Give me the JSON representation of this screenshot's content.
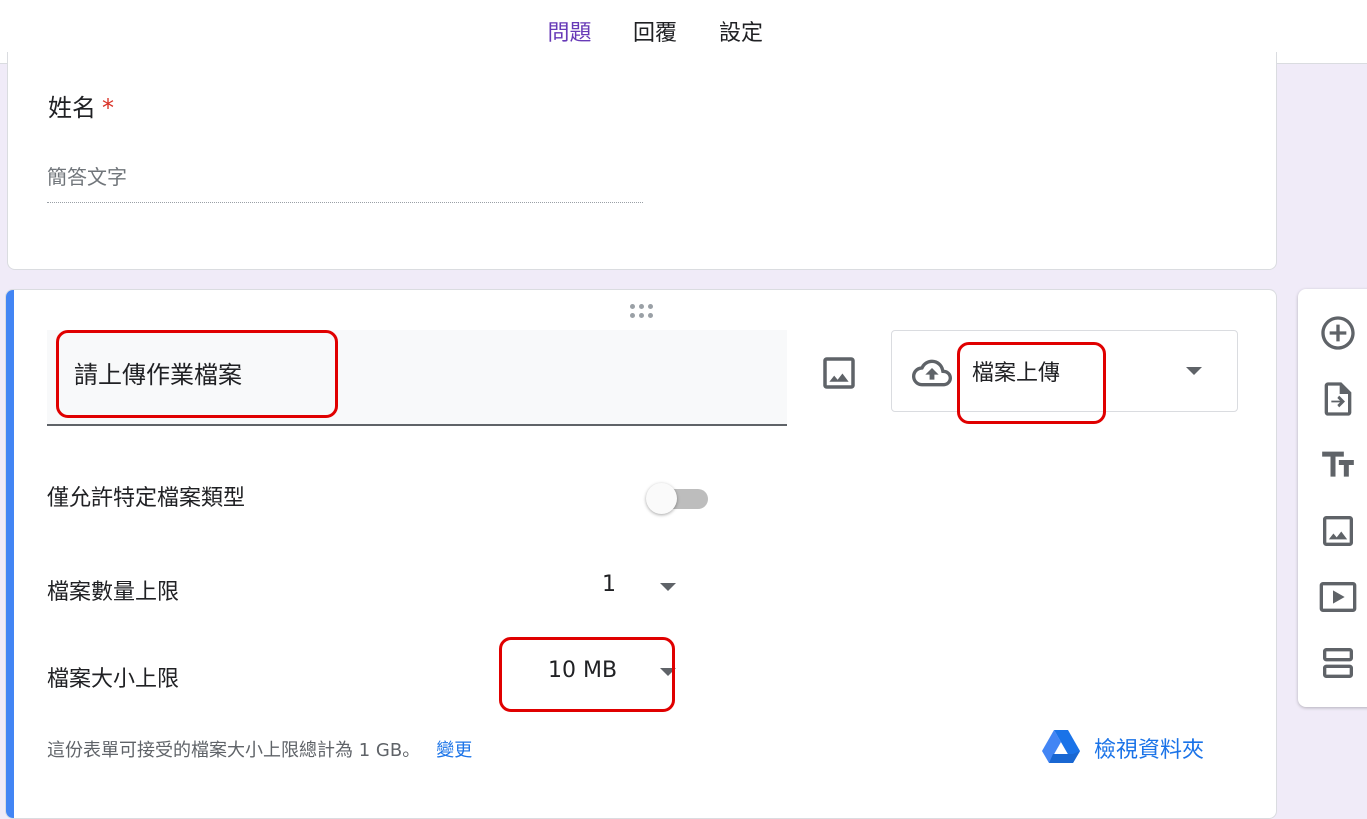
{
  "tabs": [
    {
      "label": "問題",
      "active": true
    },
    {
      "label": "回覆",
      "active": false
    },
    {
      "label": "設定",
      "active": false
    }
  ],
  "name_question": {
    "title": "姓名",
    "required_marker": "*",
    "answer_placeholder": "簡答文字"
  },
  "upload_question": {
    "title": "請上傳作業檔案",
    "type_label": "檔案上傳",
    "type_icon": "cloud-upload-icon",
    "allow_types_label": "僅允許特定檔案類型",
    "allow_types_enabled": false,
    "max_count_label": "檔案數量上限",
    "max_count_value": "1",
    "max_size_label": "檔案大小上限",
    "max_size_value": "10 MB",
    "note_text": "這份表單可接受的檔案大小上限總計為 1 GB。",
    "note_link": "變更",
    "drive_link": "檢視資料夾"
  },
  "sidebar_tools": [
    "add-question-icon",
    "import-questions-icon",
    "add-title-icon",
    "add-image-icon",
    "add-video-icon",
    "add-section-icon"
  ],
  "colors": {
    "accent": "#673ab7",
    "active_card": "#4285f4",
    "link": "#1a73e8",
    "required": "#d93025",
    "annotation": "#e00000",
    "background": "#f0ebf8"
  }
}
